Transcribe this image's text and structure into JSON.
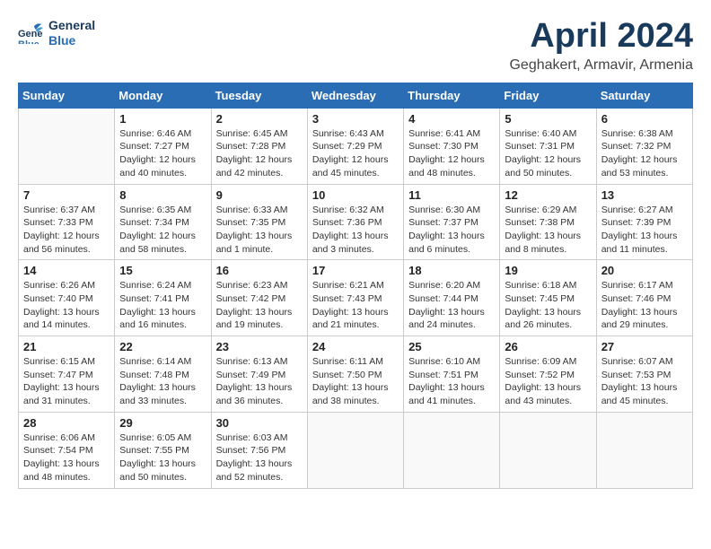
{
  "header": {
    "logo_line1": "General",
    "logo_line2": "Blue",
    "month": "April 2024",
    "location": "Geghakert, Armavir, Armenia"
  },
  "weekdays": [
    "Sunday",
    "Monday",
    "Tuesday",
    "Wednesday",
    "Thursday",
    "Friday",
    "Saturday"
  ],
  "weeks": [
    [
      {
        "day": "",
        "sunrise": "",
        "sunset": "",
        "daylight": ""
      },
      {
        "day": "1",
        "sunrise": "Sunrise: 6:46 AM",
        "sunset": "Sunset: 7:27 PM",
        "daylight": "Daylight: 12 hours and 40 minutes."
      },
      {
        "day": "2",
        "sunrise": "Sunrise: 6:45 AM",
        "sunset": "Sunset: 7:28 PM",
        "daylight": "Daylight: 12 hours and 42 minutes."
      },
      {
        "day": "3",
        "sunrise": "Sunrise: 6:43 AM",
        "sunset": "Sunset: 7:29 PM",
        "daylight": "Daylight: 12 hours and 45 minutes."
      },
      {
        "day": "4",
        "sunrise": "Sunrise: 6:41 AM",
        "sunset": "Sunset: 7:30 PM",
        "daylight": "Daylight: 12 hours and 48 minutes."
      },
      {
        "day": "5",
        "sunrise": "Sunrise: 6:40 AM",
        "sunset": "Sunset: 7:31 PM",
        "daylight": "Daylight: 12 hours and 50 minutes."
      },
      {
        "day": "6",
        "sunrise": "Sunrise: 6:38 AM",
        "sunset": "Sunset: 7:32 PM",
        "daylight": "Daylight: 12 hours and 53 minutes."
      }
    ],
    [
      {
        "day": "7",
        "sunrise": "Sunrise: 6:37 AM",
        "sunset": "Sunset: 7:33 PM",
        "daylight": "Daylight: 12 hours and 56 minutes."
      },
      {
        "day": "8",
        "sunrise": "Sunrise: 6:35 AM",
        "sunset": "Sunset: 7:34 PM",
        "daylight": "Daylight: 12 hours and 58 minutes."
      },
      {
        "day": "9",
        "sunrise": "Sunrise: 6:33 AM",
        "sunset": "Sunset: 7:35 PM",
        "daylight": "Daylight: 13 hours and 1 minute."
      },
      {
        "day": "10",
        "sunrise": "Sunrise: 6:32 AM",
        "sunset": "Sunset: 7:36 PM",
        "daylight": "Daylight: 13 hours and 3 minutes."
      },
      {
        "day": "11",
        "sunrise": "Sunrise: 6:30 AM",
        "sunset": "Sunset: 7:37 PM",
        "daylight": "Daylight: 13 hours and 6 minutes."
      },
      {
        "day": "12",
        "sunrise": "Sunrise: 6:29 AM",
        "sunset": "Sunset: 7:38 PM",
        "daylight": "Daylight: 13 hours and 8 minutes."
      },
      {
        "day": "13",
        "sunrise": "Sunrise: 6:27 AM",
        "sunset": "Sunset: 7:39 PM",
        "daylight": "Daylight: 13 hours and 11 minutes."
      }
    ],
    [
      {
        "day": "14",
        "sunrise": "Sunrise: 6:26 AM",
        "sunset": "Sunset: 7:40 PM",
        "daylight": "Daylight: 13 hours and 14 minutes."
      },
      {
        "day": "15",
        "sunrise": "Sunrise: 6:24 AM",
        "sunset": "Sunset: 7:41 PM",
        "daylight": "Daylight: 13 hours and 16 minutes."
      },
      {
        "day": "16",
        "sunrise": "Sunrise: 6:23 AM",
        "sunset": "Sunset: 7:42 PM",
        "daylight": "Daylight: 13 hours and 19 minutes."
      },
      {
        "day": "17",
        "sunrise": "Sunrise: 6:21 AM",
        "sunset": "Sunset: 7:43 PM",
        "daylight": "Daylight: 13 hours and 21 minutes."
      },
      {
        "day": "18",
        "sunrise": "Sunrise: 6:20 AM",
        "sunset": "Sunset: 7:44 PM",
        "daylight": "Daylight: 13 hours and 24 minutes."
      },
      {
        "day": "19",
        "sunrise": "Sunrise: 6:18 AM",
        "sunset": "Sunset: 7:45 PM",
        "daylight": "Daylight: 13 hours and 26 minutes."
      },
      {
        "day": "20",
        "sunrise": "Sunrise: 6:17 AM",
        "sunset": "Sunset: 7:46 PM",
        "daylight": "Daylight: 13 hours and 29 minutes."
      }
    ],
    [
      {
        "day": "21",
        "sunrise": "Sunrise: 6:15 AM",
        "sunset": "Sunset: 7:47 PM",
        "daylight": "Daylight: 13 hours and 31 minutes."
      },
      {
        "day": "22",
        "sunrise": "Sunrise: 6:14 AM",
        "sunset": "Sunset: 7:48 PM",
        "daylight": "Daylight: 13 hours and 33 minutes."
      },
      {
        "day": "23",
        "sunrise": "Sunrise: 6:13 AM",
        "sunset": "Sunset: 7:49 PM",
        "daylight": "Daylight: 13 hours and 36 minutes."
      },
      {
        "day": "24",
        "sunrise": "Sunrise: 6:11 AM",
        "sunset": "Sunset: 7:50 PM",
        "daylight": "Daylight: 13 hours and 38 minutes."
      },
      {
        "day": "25",
        "sunrise": "Sunrise: 6:10 AM",
        "sunset": "Sunset: 7:51 PM",
        "daylight": "Daylight: 13 hours and 41 minutes."
      },
      {
        "day": "26",
        "sunrise": "Sunrise: 6:09 AM",
        "sunset": "Sunset: 7:52 PM",
        "daylight": "Daylight: 13 hours and 43 minutes."
      },
      {
        "day": "27",
        "sunrise": "Sunrise: 6:07 AM",
        "sunset": "Sunset: 7:53 PM",
        "daylight": "Daylight: 13 hours and 45 minutes."
      }
    ],
    [
      {
        "day": "28",
        "sunrise": "Sunrise: 6:06 AM",
        "sunset": "Sunset: 7:54 PM",
        "daylight": "Daylight: 13 hours and 48 minutes."
      },
      {
        "day": "29",
        "sunrise": "Sunrise: 6:05 AM",
        "sunset": "Sunset: 7:55 PM",
        "daylight": "Daylight: 13 hours and 50 minutes."
      },
      {
        "day": "30",
        "sunrise": "Sunrise: 6:03 AM",
        "sunset": "Sunset: 7:56 PM",
        "daylight": "Daylight: 13 hours and 52 minutes."
      },
      {
        "day": "",
        "sunrise": "",
        "sunset": "",
        "daylight": ""
      },
      {
        "day": "",
        "sunrise": "",
        "sunset": "",
        "daylight": ""
      },
      {
        "day": "",
        "sunrise": "",
        "sunset": "",
        "daylight": ""
      },
      {
        "day": "",
        "sunrise": "",
        "sunset": "",
        "daylight": ""
      }
    ]
  ]
}
